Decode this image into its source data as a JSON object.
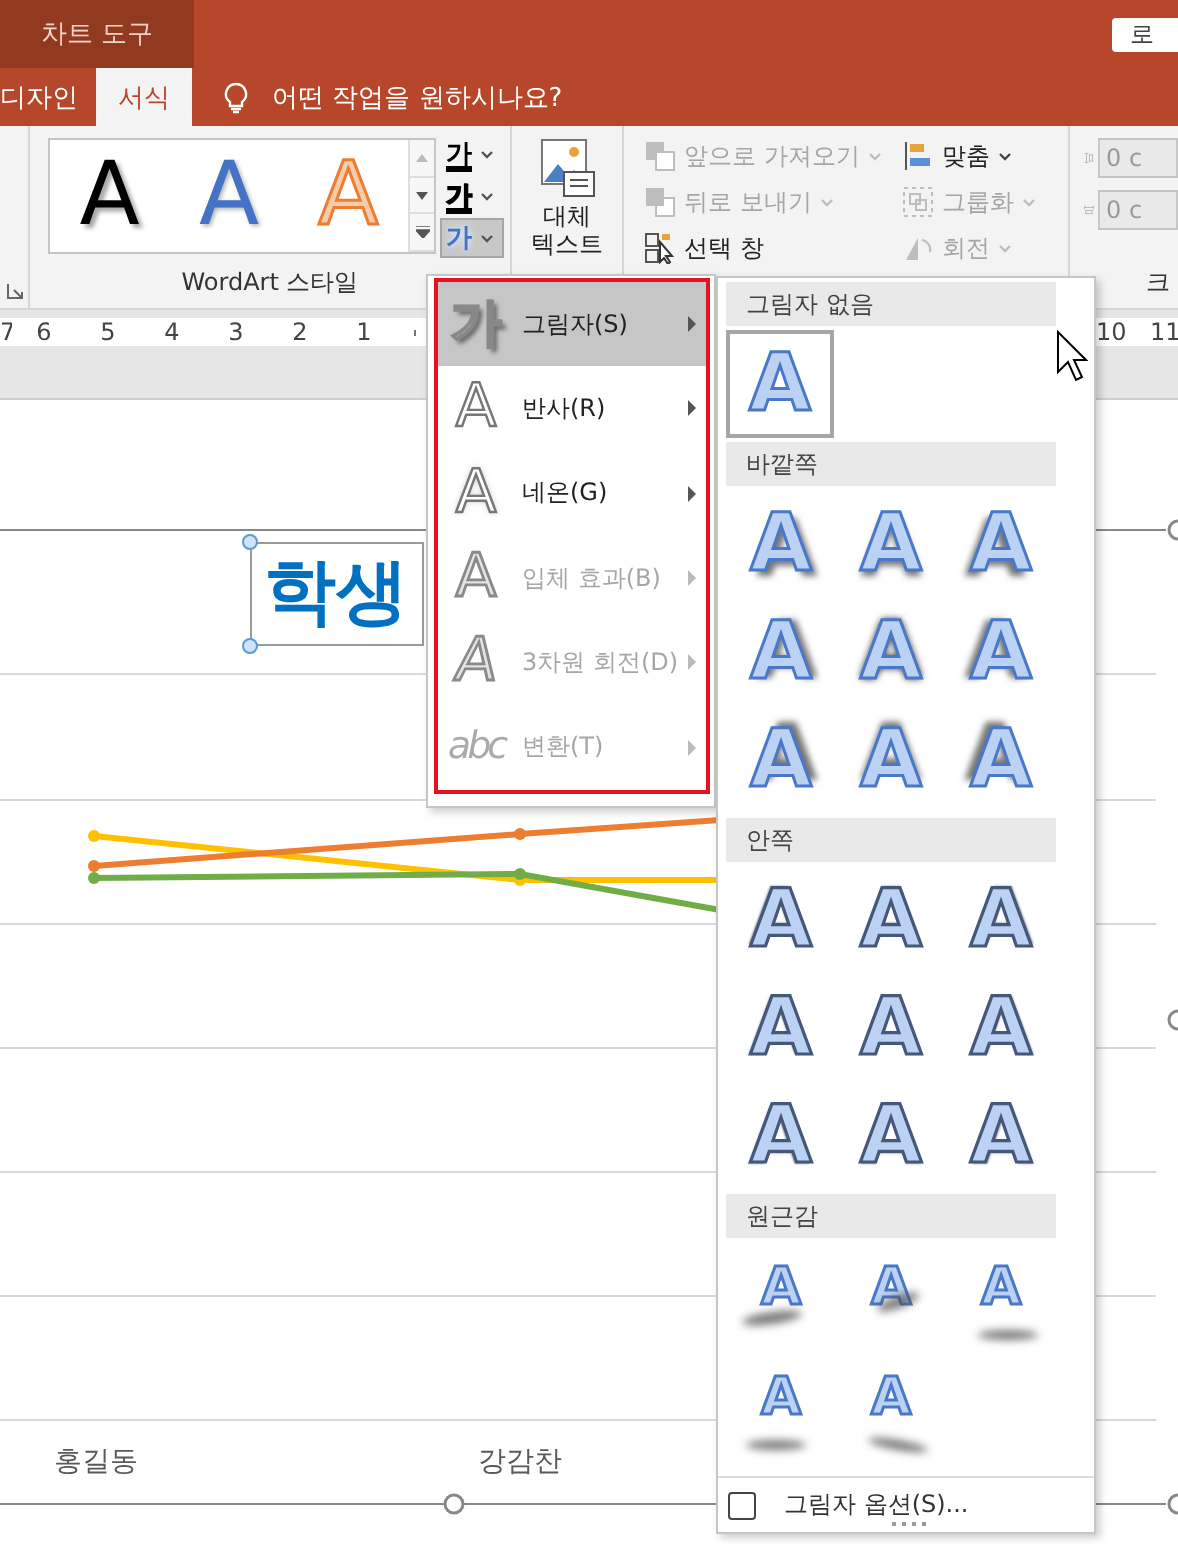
{
  "title_bar": {
    "context_tab": "차트 도구",
    "account_button": "로"
  },
  "tabs": [
    {
      "label": "디자인",
      "selected": false
    },
    {
      "label": "서식",
      "selected": true
    }
  ],
  "tell_me": {
    "label": "어떤 작업을 원하시나요?"
  },
  "wordart_styles": {
    "group_label": "WordArt 스타일",
    "swatches": [
      {
        "glyph": "A",
        "kind": "black"
      },
      {
        "glyph": "A",
        "kind": "blue"
      },
      {
        "glyph": "A",
        "kind": "orange"
      }
    ],
    "text_buttons": [
      {
        "glyph": "가",
        "kind": "fill",
        "selected": false
      },
      {
        "glyph": "가",
        "kind": "outline",
        "selected": false
      },
      {
        "glyph": "가",
        "kind": "effects",
        "selected": true
      }
    ]
  },
  "alt_text": {
    "label": "대체\n텍스트"
  },
  "arrange": {
    "commands": [
      {
        "kind": "bring-forward",
        "label": "앞으로 가져오기",
        "disabled": true,
        "dropdown": true
      },
      {
        "kind": "send-backward",
        "label": "뒤로 보내기",
        "disabled": true,
        "dropdown": true
      },
      {
        "kind": "selection-pane",
        "label": "선택 창",
        "disabled": false,
        "dropdown": false
      },
      {
        "kind": "align",
        "label": "맞춤",
        "disabled": false,
        "dropdown": true
      },
      {
        "kind": "group",
        "label": "그룹화",
        "disabled": true,
        "dropdown": true
      },
      {
        "kind": "rotate",
        "label": "회전",
        "disabled": true,
        "dropdown": true
      }
    ]
  },
  "size": {
    "group_label": "크",
    "fields": [
      {
        "kind": "height",
        "value": "0 c"
      },
      {
        "kind": "width",
        "value": "0 c"
      }
    ]
  },
  "ruler": {
    "left_marks": [
      "7",
      "6",
      "5",
      "4",
      "3",
      "2",
      "1"
    ],
    "right_marks": [
      "10",
      "11"
    ]
  },
  "chart": {
    "title": "학생",
    "categories": [
      "홍길동",
      "강감찬"
    ]
  },
  "effects_menu": {
    "items": [
      {
        "kind": "shadow",
        "icon_text": "가",
        "label": "그림자(S)",
        "selected": true,
        "disabled": false
      },
      {
        "kind": "reflection",
        "icon_text": "A",
        "label": "반사(R)",
        "selected": false,
        "disabled": false
      },
      {
        "kind": "glow",
        "icon_text": "A",
        "label": "네온(G)",
        "selected": false,
        "disabled": false
      },
      {
        "kind": "bevel",
        "icon_text": "A",
        "label": "입체 효과(B)",
        "selected": false,
        "disabled": true
      },
      {
        "kind": "rotation",
        "icon_text": "A",
        "label": "3차원 회전(D)",
        "selected": false,
        "disabled": true
      },
      {
        "kind": "transform",
        "icon_text": "abc",
        "label": "변환(T)",
        "selected": false,
        "disabled": true
      }
    ]
  },
  "shadow_gallery": {
    "sections": [
      {
        "kind": "none",
        "title": "그림자 없음",
        "items": [
          {
            "glyph": "A",
            "selected": true
          }
        ]
      },
      {
        "kind": "outer",
        "title": "바깥쪽",
        "items": [
          {
            "glyph": "A",
            "selected": false
          },
          {
            "glyph": "A",
            "selected": false
          },
          {
            "glyph": "A",
            "selected": false
          },
          {
            "glyph": "A",
            "selected": false
          },
          {
            "glyph": "A",
            "selected": false
          },
          {
            "glyph": "A",
            "selected": false
          },
          {
            "glyph": "A",
            "selected": false
          },
          {
            "glyph": "A",
            "selected": false
          },
          {
            "glyph": "A",
            "selected": false
          }
        ]
      },
      {
        "kind": "inner",
        "title": "안쪽",
        "items": [
          {
            "glyph": "A",
            "selected": false
          },
          {
            "glyph": "A",
            "selected": false
          },
          {
            "glyph": "A",
            "selected": false
          },
          {
            "glyph": "A",
            "selected": false
          },
          {
            "glyph": "A",
            "selected": false
          },
          {
            "glyph": "A",
            "selected": false
          },
          {
            "glyph": "A",
            "selected": false
          },
          {
            "glyph": "A",
            "selected": false
          },
          {
            "glyph": "A",
            "selected": false
          }
        ]
      },
      {
        "kind": "perspective",
        "title": "원근감",
        "items": [
          {
            "glyph": "A",
            "selected": false
          },
          {
            "glyph": "A",
            "selected": false
          },
          {
            "glyph": "A",
            "selected": false
          },
          {
            "glyph": "A",
            "selected": false
          },
          {
            "glyph": "A",
            "selected": false
          }
        ]
      }
    ],
    "options": {
      "label": "그림자 옵션(S)...",
      "checked": false
    }
  }
}
